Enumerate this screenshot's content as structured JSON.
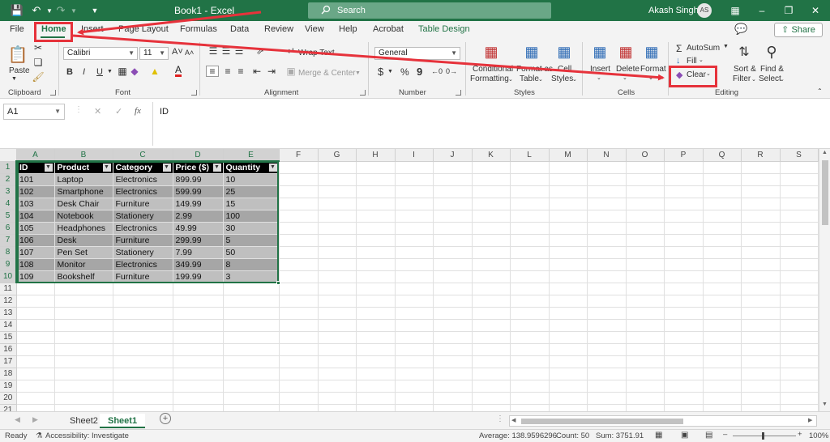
{
  "window": {
    "doc_title": "Book1  -  Excel",
    "search_placeholder": "Search",
    "user_name": "Akash Singh",
    "avatar_initials": "AS"
  },
  "tabs": [
    "File",
    "Home",
    "Insert",
    "Page Layout",
    "Formulas",
    "Data",
    "Review",
    "View",
    "Help",
    "Acrobat",
    "Table Design"
  ],
  "active_tab": "Home",
  "share_label": "Share",
  "ribbon": {
    "clipboard": {
      "label": "Clipboard",
      "paste": "Paste"
    },
    "font": {
      "label": "Font",
      "name": "Calibri",
      "size": "11",
      "bold": "B",
      "italic": "I",
      "underline": "U"
    },
    "alignment": {
      "label": "Alignment",
      "wrap": "Wrap Text",
      "merge": "Merge & Center"
    },
    "number": {
      "label": "Number",
      "format": "General",
      "currency": "$",
      "percent": "%",
      "comma": "9"
    },
    "styles": {
      "label": "Styles",
      "conditional_1": "Conditional",
      "conditional_2": "Formatting",
      "format_table_1": "Format as",
      "format_table_2": "Table",
      "cell_styles_1": "Cell",
      "cell_styles_2": "Styles"
    },
    "cells": {
      "label": "Cells",
      "insert": "Insert",
      "delete": "Delete",
      "format": "Format"
    },
    "editing": {
      "label": "Editing",
      "autosum": "AutoSum",
      "fill": "Fill",
      "clear": "Clear",
      "sort_1": "Sort &",
      "sort_2": "Filter",
      "find_1": "Find &",
      "find_2": "Select"
    }
  },
  "formula_bar": {
    "name_box": "A1",
    "fx": "fx",
    "content": "ID"
  },
  "columns": [
    "A",
    "B",
    "C",
    "D",
    "E",
    "F",
    "G",
    "H",
    "I",
    "J",
    "K",
    "L",
    "M",
    "N",
    "O",
    "P",
    "Q",
    "R",
    "S"
  ],
  "rows": [
    "1",
    "2",
    "3",
    "4",
    "5",
    "6",
    "7",
    "8",
    "9",
    "10",
    "11",
    "12",
    "13",
    "14",
    "15",
    "16",
    "17",
    "18",
    "19",
    "20",
    "21"
  ],
  "table": {
    "headers": [
      "ID",
      "Product",
      "Category",
      "Price ($)",
      "Quantity"
    ],
    "rows": [
      [
        "101",
        "Laptop",
        "Electronics",
        "899.99",
        "10"
      ],
      [
        "102",
        "Smartphone",
        "Electronics",
        "599.99",
        "25"
      ],
      [
        "103",
        "Desk Chair",
        "Furniture",
        "149.99",
        "15"
      ],
      [
        "104",
        "Notebook",
        "Stationery",
        "2.99",
        "100"
      ],
      [
        "105",
        "Headphones",
        "Electronics",
        "49.99",
        "30"
      ],
      [
        "106",
        "Desk",
        "Furniture",
        "299.99",
        "5"
      ],
      [
        "107",
        "Pen Set",
        "Stationery",
        "7.99",
        "50"
      ],
      [
        "108",
        "Monitor",
        "Electronics",
        "349.99",
        "8"
      ],
      [
        "109",
        "Bookshelf",
        "Furniture",
        "199.99",
        "3"
      ]
    ]
  },
  "sheets": [
    "Sheet2",
    "Sheet1"
  ],
  "active_sheet": "Sheet1",
  "status": {
    "ready": "Ready",
    "accessibility": "Accessibility: Investigate",
    "average": "Average: 138.9596296",
    "count": "Count: 50",
    "sum": "Sum: 3751.91",
    "zoom": "100%"
  },
  "colors": {
    "accent": "#217346",
    "annotation": "#e6323b",
    "header_fill": "#000000",
    "band_fill": "#a6a6a6"
  }
}
